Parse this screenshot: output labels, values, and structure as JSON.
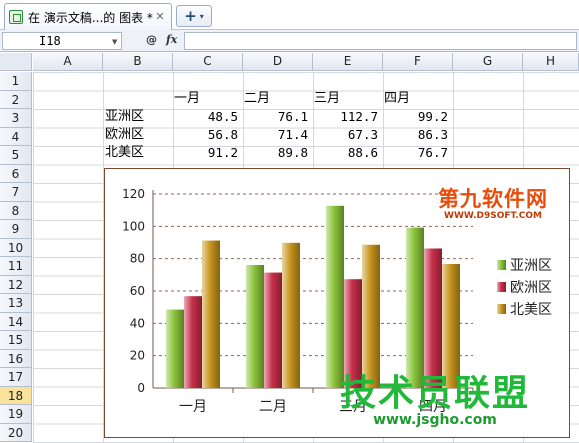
{
  "tab": {
    "title": "在 演示文稿...的 图表 *",
    "close": "✕"
  },
  "new_tab": {
    "plus": "+",
    "arrow": "▾"
  },
  "formula_bar": {
    "cell_ref": "I18",
    "search_icon": "🔍",
    "fx": "fx",
    "value": ""
  },
  "columns": [
    "A",
    "B",
    "C",
    "D",
    "E",
    "F",
    "G",
    "H"
  ],
  "rows": [
    "1",
    "2",
    "3",
    "4",
    "5",
    "6",
    "7",
    "8",
    "9",
    "10",
    "11",
    "12",
    "13",
    "14",
    "15",
    "16",
    "17",
    "18",
    "19",
    "20"
  ],
  "selected_row": "18",
  "table": {
    "headers": [
      "一月",
      "二月",
      "三月",
      "四月"
    ],
    "rows": [
      {
        "label": "亚洲区",
        "values": [
          "48.5",
          "76.1",
          "112.7",
          "99.2"
        ]
      },
      {
        "label": "欧洲区",
        "values": [
          "56.8",
          "71.4",
          "67.3",
          "86.3"
        ]
      },
      {
        "label": "北美区",
        "values": [
          "91.2",
          "89.8",
          "88.6",
          "76.7"
        ]
      }
    ]
  },
  "chart_data": {
    "type": "bar",
    "categories": [
      "一月",
      "二月",
      "三月",
      "四月"
    ],
    "series": [
      {
        "name": "亚洲区",
        "values": [
          48.5,
          76.1,
          112.7,
          99.2
        ],
        "color": "#8ac43a"
      },
      {
        "name": "欧洲区",
        "values": [
          56.8,
          71.4,
          67.3,
          86.3
        ],
        "color": "#c8304a"
      },
      {
        "name": "北美区",
        "values": [
          91.2,
          89.8,
          88.6,
          76.7
        ],
        "color": "#c8961e"
      }
    ],
    "yticks": [
      "0",
      "20",
      "40",
      "60",
      "80",
      "100",
      "120"
    ],
    "ylim": [
      0,
      120
    ],
    "grid": true,
    "legend": "right"
  },
  "watermarks": {
    "top_text": "第九软件网",
    "top_url": "WWW.D9SOFT.COM",
    "bottom_text": "技术员联盟",
    "bottom_url": "www.jsgho.com"
  }
}
